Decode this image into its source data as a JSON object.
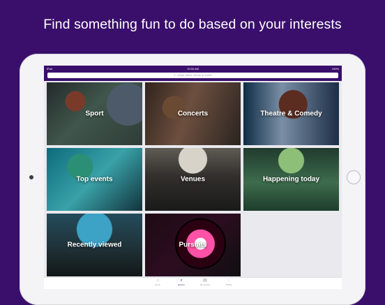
{
  "headline": "Find something fun to do based on your interests",
  "status": {
    "left": "iPad",
    "time": "10:00 AM",
    "battery": "100%"
  },
  "search": {
    "placeholder": "Artist, team, venue or event"
  },
  "tiles": [
    {
      "label": "Sport"
    },
    {
      "label": "Concerts"
    },
    {
      "label": "Theatre & Comedy"
    },
    {
      "label": "Top events"
    },
    {
      "label": "Venues"
    },
    {
      "label": "Happening today"
    },
    {
      "label": "Recently viewed"
    },
    {
      "label": "Pursuits"
    }
  ],
  "bottom_nav": [
    {
      "label": "Home",
      "icon": "home-icon"
    },
    {
      "label": "Explore",
      "icon": "explore-icon"
    },
    {
      "label": "My Tickets",
      "icon": "tickets-icon"
    },
    {
      "label": "Profile",
      "icon": "profile-icon"
    }
  ]
}
